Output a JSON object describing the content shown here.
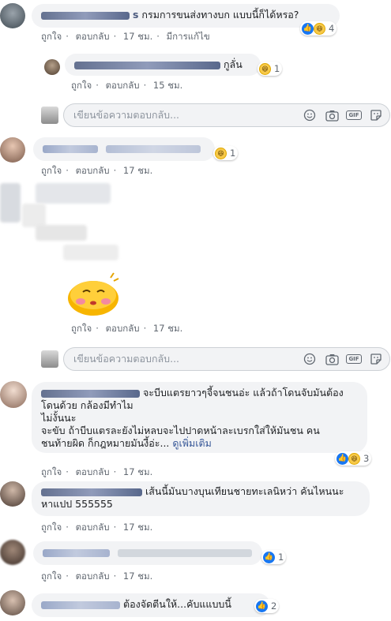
{
  "comments": [
    {
      "text": "กรมการขนส่งทางบก แบบนี้ก็ได้หรอ?",
      "meta": {
        "like": "ถูกใจ",
        "reply": "ตอบกลับ",
        "time": "17 ชม.",
        "edited": "มีการแก้ไข"
      },
      "reaction_count": "4"
    },
    {
      "text": "กูลั่น",
      "meta": {
        "like": "ถูกใจ",
        "reply": "ตอบกลับ",
        "time": "15 ชม."
      },
      "reaction_count": "1"
    },
    {
      "meta": {
        "like": "ถูกใจ",
        "reply": "ตอบกลับ",
        "time": "17 ชม."
      },
      "reaction_count": "1"
    },
    {
      "meta": {
        "like": "ถูกใจ",
        "reply": "ตอบกลับ",
        "time": "17 ชม."
      }
    },
    {
      "text": "จะบีบแตรยาวๆจี้จนชนอ่ะ แล้วถ้าโดนจับมันต้องโดนด้วย กล้องมีทำไม",
      "text2": "ไม่งั้นนะ",
      "text3": "จะขับ ถ้าบีบแตรละยังไม่หลบจะไปปาดหน้าละเบรกใส่ให้มันชน คน",
      "text4": "ชนท้ายผิด ก็กฎหมายมันงี้อ่ะ...",
      "see_more": "ดูเพิ่มเติม",
      "meta": {
        "like": "ถูกใจ",
        "reply": "ตอบกลับ",
        "time": "17 ชม."
      },
      "reaction_count": "3"
    },
    {
      "text": "เส้นนี้มันบางบุนเทียนชายทะเลนิหว่า คันไหนนะ",
      "text2": "หาแปป 555555",
      "meta": {
        "like": "ถูกใจ",
        "reply": "ตอบกลับ",
        "time": "17 ชม."
      }
    },
    {
      "meta": {
        "like": "ถูกใจ",
        "reply": "ตอบกลับ",
        "time": "17 ชม."
      },
      "reaction_count": "1"
    },
    {
      "text": "ต้องจัดตีนให้...คับแแบบนี้",
      "reaction_count": "2"
    }
  ],
  "reply_box": {
    "placeholder": "เขียนข้อความตอบกลับ..."
  },
  "icons": [
    "emoji-icon",
    "camera-icon",
    "gif-icon",
    "sticker-icon"
  ]
}
